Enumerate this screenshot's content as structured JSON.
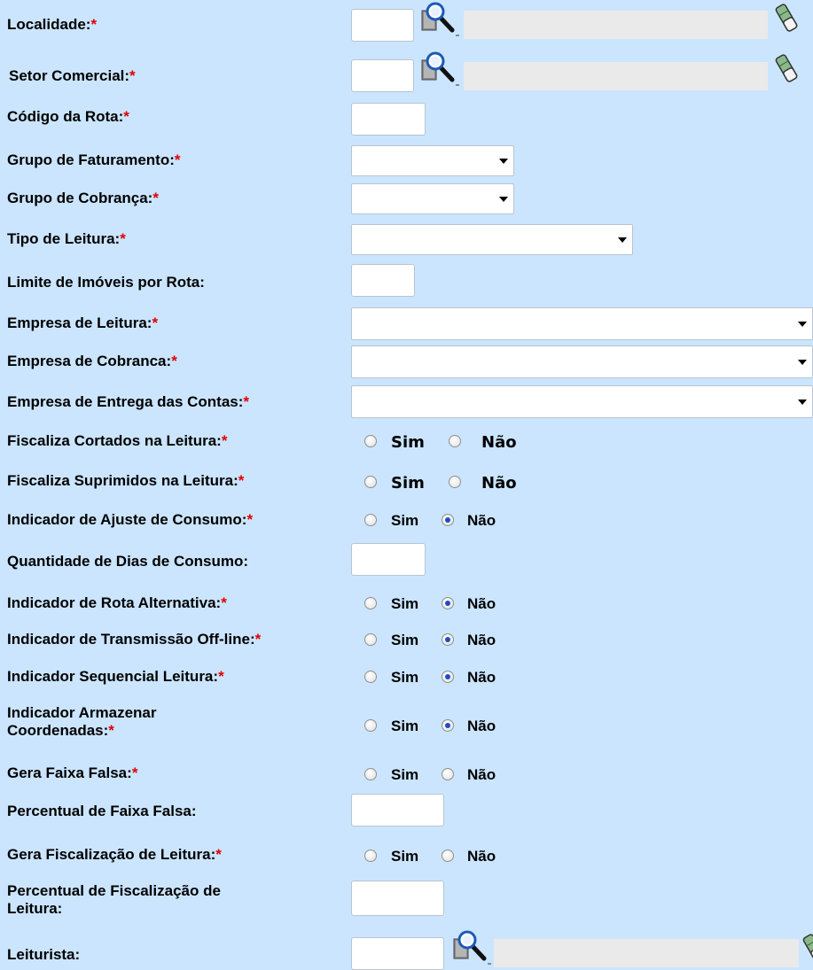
{
  "required_mark": "*",
  "colors": {
    "background": "#cbe5fe",
    "required": "#e00000",
    "radio_checked": "#1a4fbf"
  },
  "icons": {
    "search": "magnifier-search-icon",
    "clear": "eraser-clear-icon"
  },
  "fields": {
    "localidade": {
      "label": "Localidade:",
      "required": true,
      "code_value": "",
      "description_value": ""
    },
    "setor_comercial": {
      "label": "Setor Comercial:",
      "required": true,
      "code_value": "",
      "description_value": ""
    },
    "codigo_rota": {
      "label": "Código da Rota:",
      "required": true,
      "value": ""
    },
    "grupo_faturamento": {
      "label": "Grupo de Faturamento:",
      "required": true,
      "selected": ""
    },
    "grupo_cobranca": {
      "label": "Grupo de Cobrança:",
      "required": true,
      "selected": ""
    },
    "tipo_leitura": {
      "label": "Tipo de Leitura:",
      "required": true,
      "selected": ""
    },
    "limite_imoveis": {
      "label": "Limite de Imóveis por Rota:",
      "required": false,
      "value": ""
    },
    "empresa_leitura": {
      "label": "Empresa de Leitura:",
      "required": true,
      "selected": ""
    },
    "empresa_cobranca": {
      "label": "Empresa de Cobranca:",
      "required": true,
      "selected": ""
    },
    "empresa_entrega": {
      "label": "Empresa de Entrega das Contas:",
      "required": true,
      "selected": ""
    },
    "fiscaliza_cortados": {
      "label": "Fiscaliza Cortados na Leitura:",
      "required": true,
      "sim": "Sim",
      "nao": "Não",
      "selected": ""
    },
    "fiscaliza_suprimidos": {
      "label": "Fiscaliza Suprimidos na Leitura:",
      "required": true,
      "sim": "Sim",
      "nao": "Não",
      "selected": ""
    },
    "ajuste_consumo": {
      "label": "Indicador de Ajuste de Consumo:",
      "required": true,
      "sim": "Sim",
      "nao": "Não",
      "selected": "Não"
    },
    "dias_consumo": {
      "label": "Quantidade de Dias de Consumo:",
      "required": false,
      "value": ""
    },
    "rota_alternativa": {
      "label": "Indicador de Rota Alternativa:",
      "required": true,
      "sim": "Sim",
      "nao": "Não",
      "selected": "Não"
    },
    "transmissao_offline": {
      "label": "Indicador de Transmissão Off-line:",
      "required": true,
      "sim": "Sim",
      "nao": "Não",
      "selected": "Não"
    },
    "sequencial_leitura": {
      "label": "Indicador Sequencial Leitura:",
      "required": true,
      "sim": "Sim",
      "nao": "Não",
      "selected": "Não"
    },
    "armazenar_coordenadas": {
      "label_line1": "Indicador Armazenar",
      "label_line2": "Coordenadas:",
      "required": true,
      "sim": "Sim",
      "nao": "Não",
      "selected": "Não"
    },
    "gera_faixa_falsa": {
      "label": "Gera Faixa Falsa:",
      "required": true,
      "sim": "Sim",
      "nao": "Não",
      "selected": ""
    },
    "percentual_faixa_falsa": {
      "label": "Percentual de Faixa Falsa:",
      "required": false,
      "value": ""
    },
    "gera_fiscalizacao": {
      "label": "Gera Fiscalização de Leitura:",
      "required": true,
      "sim": "Sim",
      "nao": "Não",
      "selected": ""
    },
    "percentual_fiscalizacao": {
      "label_line1": "Percentual de Fiscalização de",
      "label_line2": "Leitura:",
      "required": false,
      "value": ""
    },
    "leiturista": {
      "label": "Leiturista:",
      "required": false,
      "code_value": "",
      "description_value": ""
    }
  }
}
